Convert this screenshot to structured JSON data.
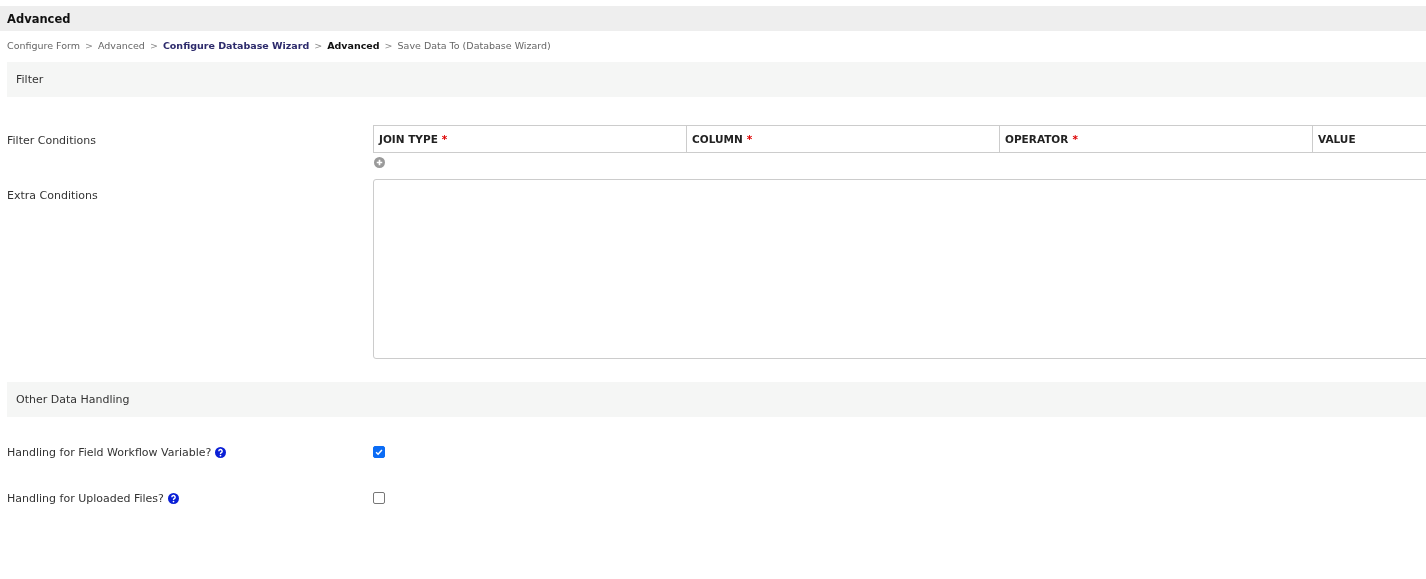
{
  "header": {
    "title": "Advanced"
  },
  "breadcrumb": {
    "separator": ">",
    "items": [
      {
        "label": "Configure Form",
        "kind": "plain"
      },
      {
        "label": "Advanced",
        "kind": "plain"
      },
      {
        "label": "Configure Database Wizard",
        "kind": "link"
      },
      {
        "label": "Advanced",
        "kind": "current"
      },
      {
        "label": "Save Data To (Database Wizard)",
        "kind": "plain"
      }
    ]
  },
  "filter_section": {
    "title": "Filter",
    "filter_conditions": {
      "label": "Filter Conditions",
      "columns": [
        {
          "label": "JOIN TYPE",
          "required": true
        },
        {
          "label": "COLUMN",
          "required": true
        },
        {
          "label": "OPERATOR",
          "required": true
        },
        {
          "label": "VALUE",
          "required": false
        }
      ],
      "required_mark": "*"
    },
    "extra_conditions": {
      "label": "Extra Conditions"
    }
  },
  "other_section": {
    "title": "Other Data Handling",
    "options": [
      {
        "label": "Handling for Field Workflow Variable?",
        "checked": true
      },
      {
        "label": "Handling for Uploaded Files?",
        "checked": false
      }
    ]
  }
}
